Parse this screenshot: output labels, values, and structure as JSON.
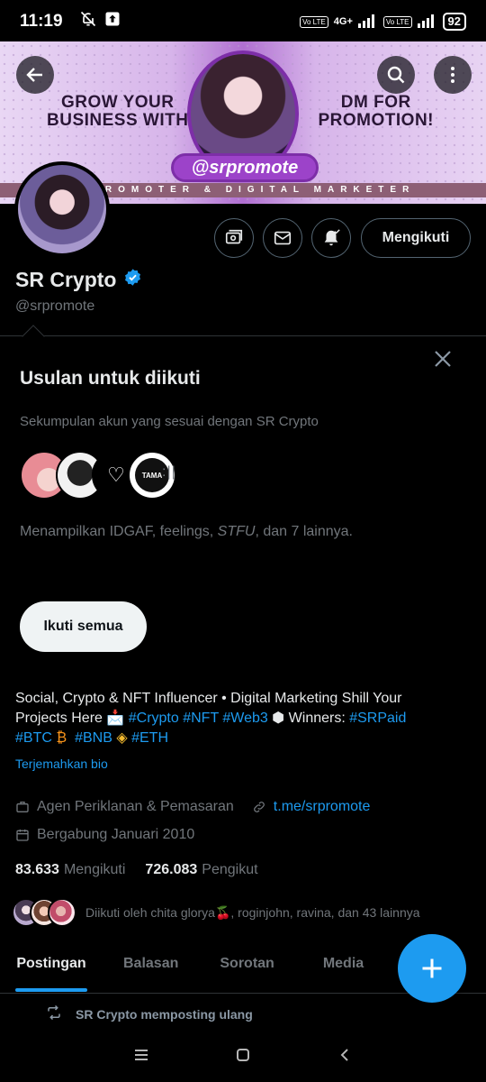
{
  "status_bar": {
    "time": "11:19",
    "network": "4G+",
    "lte1": "Vo LTE",
    "lte2": "Vo LTE",
    "battery": "92"
  },
  "banner": {
    "left_text_line1": "GROW YOUR",
    "left_text_line2": "BUSINESS WITH",
    "right_text_line1": "DM FOR",
    "right_text_line2": "PROMOTION!",
    "handle_tag": "@srpromote",
    "strip_text": "O PROMOTER & DIGITAL MARKETER"
  },
  "profile": {
    "name": "SR Crypto",
    "handle": "@srpromote",
    "follow_label": "Mengikuti",
    "verified_color": "#1d9bf0"
  },
  "suggestions": {
    "title": "Usulan untuk diikuti",
    "subtitle": "Sekumpulan akun yang sesuai dengan SR Crypto",
    "avatar_tama": "TAMA",
    "names_prefix": "Menampilkan IDGAF, feelings, ",
    "names_italic": "STFU",
    "names_suffix": ", dan 7 lainnya.",
    "follow_all_label": "Ikuti semua"
  },
  "bio": {
    "text1": "Social, Crypto & NFT Influencer • Digital Marketing Shill Your Projects Here 📩 ",
    "tag_crypto": "#Crypto",
    "tag_nft": "#NFT",
    "tag_web3": "#Web3",
    "text2": " ⬢  Winners: ",
    "tag_srpaid": "#SRPaid",
    "tag_btc": "#BTC",
    "btc_glyph": "₿",
    "tag_bnb": "#BNB",
    "bnb_glyph": "◈",
    "tag_eth": "#ETH",
    "translate_label": "Terjemahkan bio"
  },
  "meta": {
    "category": "Agen Periklanan & Pemasaran",
    "link": "t.me/srpromote",
    "joined": "Bergabung Januari 2010"
  },
  "stats": {
    "following_count": "83.633",
    "following_label": "Mengikuti",
    "followers_count": "726.083",
    "followers_label": "Pengikut"
  },
  "followed_by": {
    "text": "Diikuti oleh chita glorya🍒, roginjohn, ravina, dan 43 lainnya"
  },
  "tabs": [
    "Postingan",
    "Balasan",
    "Sorotan",
    "Media"
  ],
  "repost": {
    "text": "SR Crypto memposting ulang"
  },
  "colors": {
    "accent": "#1d9bf0",
    "muted": "#71767b",
    "background": "#000000"
  }
}
